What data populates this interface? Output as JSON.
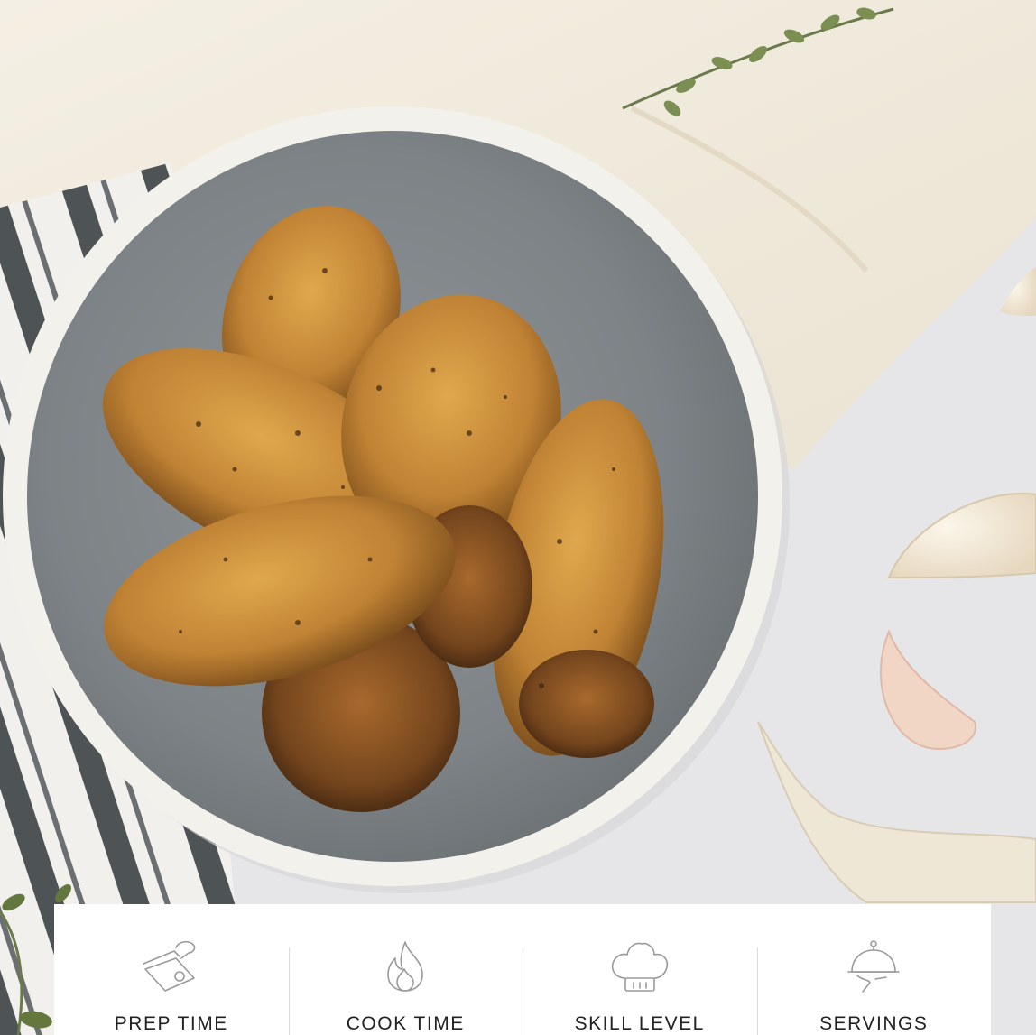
{
  "info_bar": {
    "items": [
      {
        "label": "PREP TIME",
        "icon": "cutting-board-knife-icon"
      },
      {
        "label": "COOK TIME",
        "icon": "flame-icon"
      },
      {
        "label": "SKILL LEVEL",
        "icon": "chef-hat-icon"
      },
      {
        "label": "SERVINGS",
        "icon": "cloche-platter-icon"
      }
    ]
  },
  "colors": {
    "card_background": "#ffffff",
    "icon_stroke": "#9a9a9a",
    "label_text": "#222222",
    "divider": "#dcdcdc"
  }
}
